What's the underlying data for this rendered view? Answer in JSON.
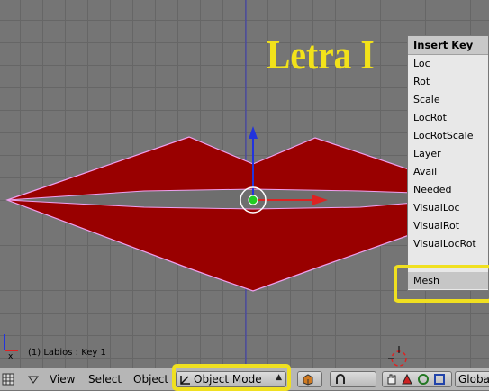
{
  "viewport": {
    "caption": "Letra I",
    "status": "(1) Labios : Key 1"
  },
  "insert_key_menu": {
    "title": "Insert Key",
    "items": [
      "Loc",
      "Rot",
      "Scale",
      "LocRot",
      "LocRotScale",
      "Layer",
      "Avail",
      "Needed",
      "VisualLoc",
      "VisualRot",
      "VisualLocRot"
    ],
    "highlighted_item": "Mesh"
  },
  "header": {
    "menus": [
      "View",
      "Select",
      "Object"
    ],
    "mode_selector": "Object Mode",
    "orientation": "Global"
  },
  "colors": {
    "mesh_fill": "#990000",
    "mesh_edge": "#f0a0f0",
    "caption": "#f2e21a",
    "highlight": "#f0e020"
  },
  "icons": [
    "grid-icon",
    "triangle-down-icon",
    "axis-widget-icon",
    "3d-cursor-icon",
    "mesh-cube-icon",
    "magnet-icon",
    "hand-icon",
    "rotate-icon",
    "scale-icon"
  ]
}
